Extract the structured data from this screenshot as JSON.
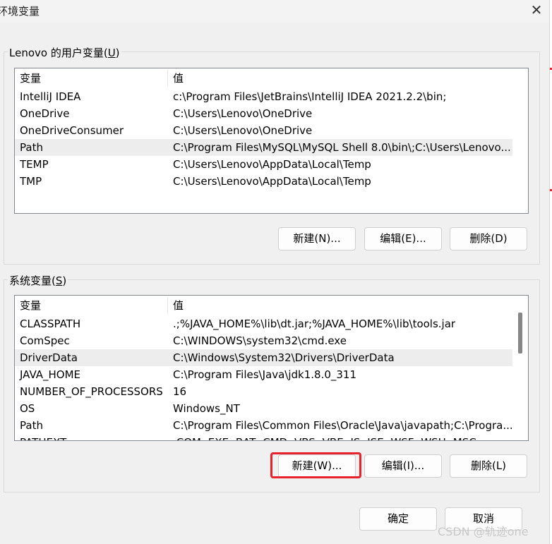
{
  "window": {
    "title": "环境变量",
    "close_glyph": "✕"
  },
  "user_vars": {
    "legend_prefix": "Lenovo 的用户变量(",
    "legend_key": "U",
    "legend_suffix": ")",
    "header": {
      "name": "变量",
      "value": "值"
    },
    "rows": [
      {
        "name": "IntelliJ IDEA",
        "value": "c:\\Program Files\\JetBrains\\IntelliJ IDEA 2021.2.2\\bin;"
      },
      {
        "name": "OneDrive",
        "value": "C:\\Users\\Lenovo\\OneDrive"
      },
      {
        "name": "OneDriveConsumer",
        "value": "C:\\Users\\Lenovo\\OneDrive"
      },
      {
        "name": "Path",
        "value": "C:\\Program Files\\MySQL\\MySQL Shell 8.0\\bin\\;C:\\Users\\Lenovo..."
      },
      {
        "name": "TEMP",
        "value": "C:\\Users\\Lenovo\\AppData\\Local\\Temp"
      },
      {
        "name": "TMP",
        "value": "C:\\Users\\Lenovo\\AppData\\Local\\Temp"
      }
    ],
    "selected_row": "Path",
    "buttons": {
      "new": "新建(N)...",
      "edit": "编辑(E)...",
      "delete": "删除(D)"
    }
  },
  "system_vars": {
    "legend_prefix": "系统变量(",
    "legend_key": "S",
    "legend_suffix": ")",
    "header": {
      "name": "变量",
      "value": "值"
    },
    "rows": [
      {
        "name": "CLASSPATH",
        "value": ".;%JAVA_HOME%\\lib\\dt.jar;%JAVA_HOME%\\lib\\tools.jar"
      },
      {
        "name": "ComSpec",
        "value": "C:\\WINDOWS\\system32\\cmd.exe"
      },
      {
        "name": "DriverData",
        "value": "C:\\Windows\\System32\\Drivers\\DriverData"
      },
      {
        "name": "JAVA_HOME",
        "value": "C:\\Program Files\\Java\\jdk1.8.0_311"
      },
      {
        "name": "NUMBER_OF_PROCESSORS",
        "value": "16"
      },
      {
        "name": "OS",
        "value": "Windows_NT"
      },
      {
        "name": "Path",
        "value": "C:\\Program Files\\Common Files\\Oracle\\Java\\javapath;C:\\Progra..."
      },
      {
        "name": "PATHEXT",
        "value": ".COM;.EXE;.BAT;.CMD;.VBS;.VBE;.JS;.JSE;.WSF;.WSH;.MSC"
      }
    ],
    "selected_row": "DriverData",
    "buttons": {
      "new": "新建(W)...",
      "edit": "编辑(I)...",
      "delete": "删除(L)"
    }
  },
  "footer": {
    "ok": "确定",
    "cancel": "取消"
  },
  "watermark": "CSDN @轨迹one",
  "colors": {
    "highlight": "#e8222d",
    "selection": "#ededed"
  }
}
